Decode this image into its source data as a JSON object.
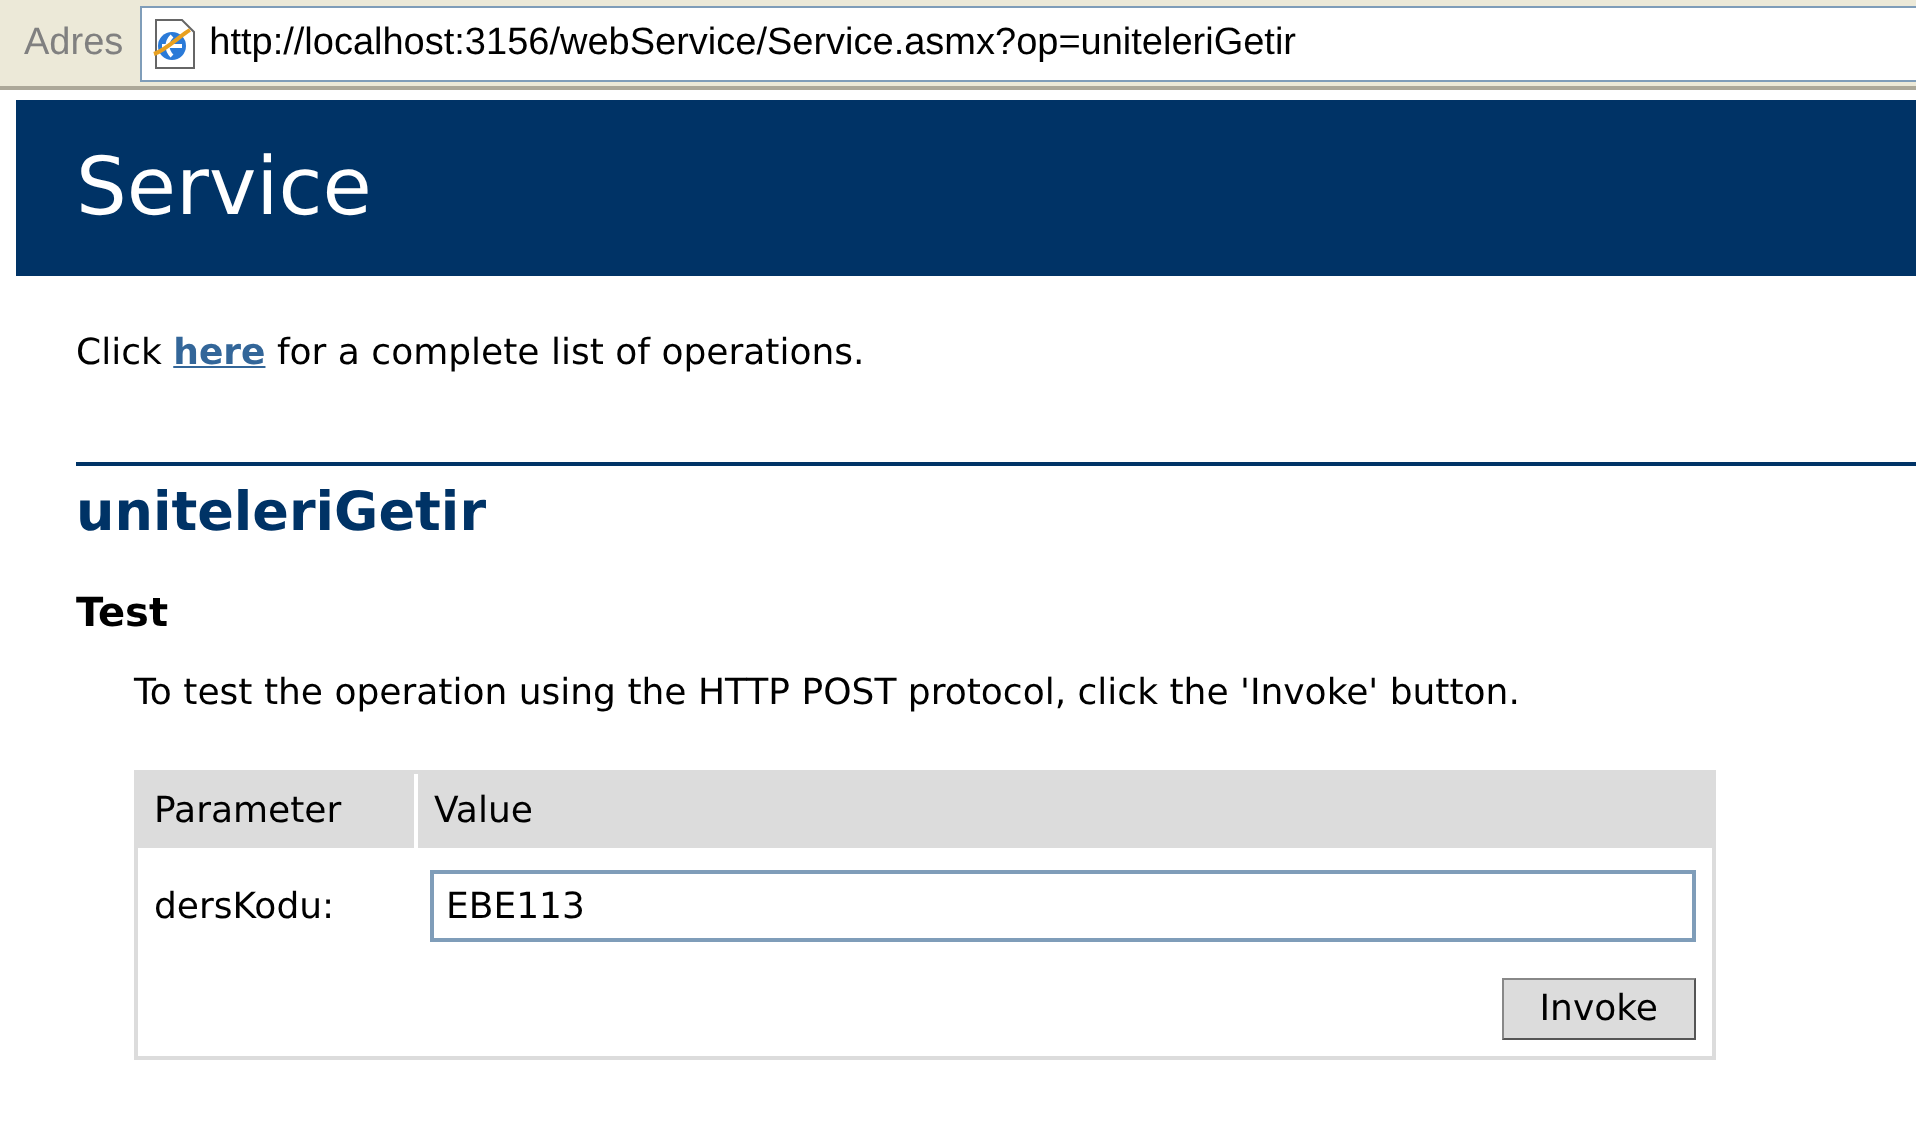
{
  "address_bar": {
    "label": "Adres",
    "url": "http://localhost:3156/webService/Service.asmx?op=uniteleriGetir"
  },
  "banner": {
    "title": "Service"
  },
  "intro": {
    "before": "Click ",
    "link": "here",
    "after": " for a complete list of operations."
  },
  "operation": {
    "name": "uniteleriGetir"
  },
  "test": {
    "heading": "Test",
    "description": "To test the operation using the HTTP POST protocol, click the 'Invoke' button."
  },
  "table": {
    "columns": [
      "Parameter",
      "Value"
    ],
    "rows": [
      {
        "parameter": "dersKodu:",
        "value": "EBE113"
      }
    ]
  },
  "buttons": [
    "Invoke"
  ]
}
